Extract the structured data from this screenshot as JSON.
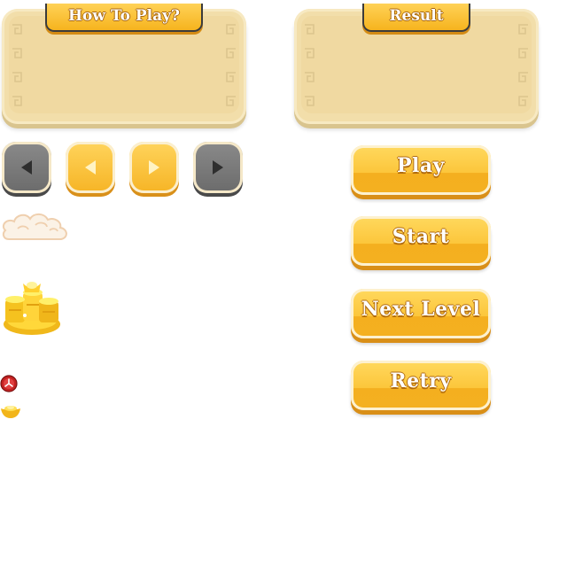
{
  "panels": {
    "how_to_play": {
      "title": "How To Play?"
    },
    "result": {
      "title": "Result"
    }
  },
  "nav_buttons": [
    {
      "icon": "left-arrow-icon",
      "style": "gray"
    },
    {
      "icon": "left-arrow-icon",
      "style": "gold"
    },
    {
      "icon": "right-arrow-icon",
      "style": "gold"
    },
    {
      "icon": "right-arrow-icon",
      "style": "gray"
    }
  ],
  "buttons": {
    "play": "Play",
    "start": "Start",
    "next_level": "Next Level",
    "retry": "Retry"
  },
  "decorations": [
    "cloud-icon",
    "gold-ingot-pile-icon",
    "clock-icon",
    "gold-ingot-icon"
  ],
  "colors": {
    "gold": "#f6b425",
    "panel": "#f2deaa",
    "gray": "#6b6b6b",
    "text_outline": "#b06a10"
  }
}
